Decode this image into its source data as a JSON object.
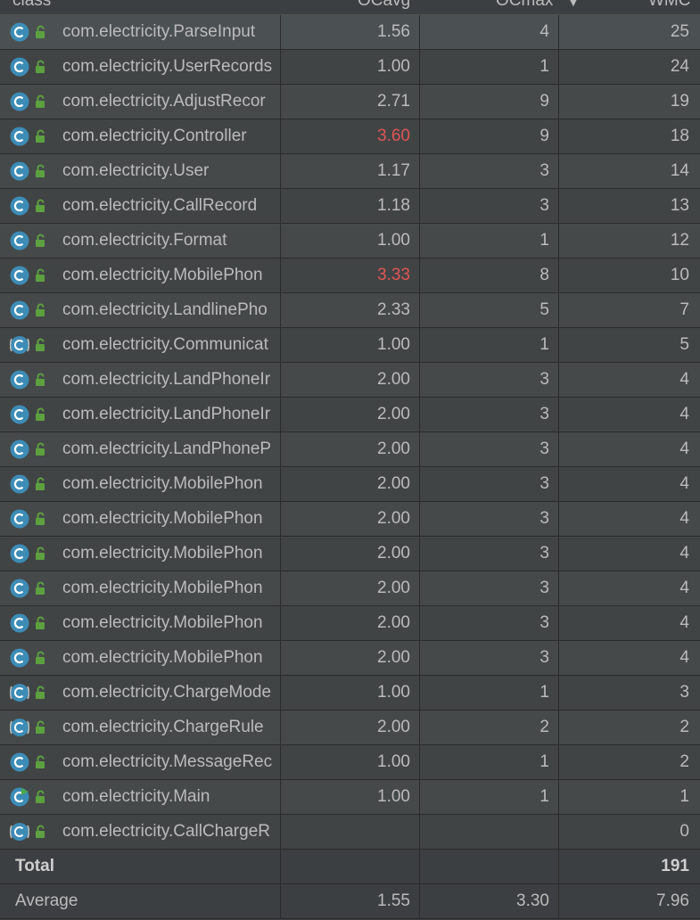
{
  "columns": [
    "class",
    "OCavg",
    "OCmax",
    "WMC"
  ],
  "sort_indicator": "▼",
  "rows": [
    {
      "name": "com.electricity.ParseInput",
      "icon": "class-icon",
      "avg": "1.56",
      "max": "4",
      "wmc": "25",
      "warn": false
    },
    {
      "name": "com.electricity.UserRecords",
      "icon": "class-icon",
      "avg": "1.00",
      "max": "1",
      "wmc": "24",
      "warn": false
    },
    {
      "name": "com.electricity.AdjustRecor",
      "icon": "class-icon",
      "avg": "2.71",
      "max": "9",
      "wmc": "19",
      "warn": false
    },
    {
      "name": "com.electricity.Controller",
      "icon": "class-icon",
      "avg": "3.60",
      "max": "9",
      "wmc": "18",
      "warn": true
    },
    {
      "name": "com.electricity.User",
      "icon": "class-icon",
      "avg": "1.17",
      "max": "3",
      "wmc": "14",
      "warn": false
    },
    {
      "name": "com.electricity.CallRecord",
      "icon": "class-icon",
      "avg": "1.18",
      "max": "3",
      "wmc": "13",
      "warn": false
    },
    {
      "name": "com.electricity.Format",
      "icon": "class-icon",
      "avg": "1.00",
      "max": "1",
      "wmc": "12",
      "warn": false
    },
    {
      "name": "com.electricity.MobilePhon",
      "icon": "class-icon",
      "avg": "3.33",
      "max": "8",
      "wmc": "10",
      "warn": true
    },
    {
      "name": "com.electricity.LandlinePho",
      "icon": "class-icon",
      "avg": "2.33",
      "max": "5",
      "wmc": "7",
      "warn": false
    },
    {
      "name": "com.electricity.Communicat",
      "icon": "abstract-class-icon",
      "avg": "1.00",
      "max": "1",
      "wmc": "5",
      "warn": false
    },
    {
      "name": "com.electricity.LandPhoneIr",
      "icon": "class-icon",
      "avg": "2.00",
      "max": "3",
      "wmc": "4",
      "warn": false
    },
    {
      "name": "com.electricity.LandPhoneIr",
      "icon": "class-icon",
      "avg": "2.00",
      "max": "3",
      "wmc": "4",
      "warn": false
    },
    {
      "name": "com.electricity.LandPhoneP",
      "icon": "class-icon",
      "avg": "2.00",
      "max": "3",
      "wmc": "4",
      "warn": false
    },
    {
      "name": "com.electricity.MobilePhon",
      "icon": "class-icon",
      "avg": "2.00",
      "max": "3",
      "wmc": "4",
      "warn": false
    },
    {
      "name": "com.electricity.MobilePhon",
      "icon": "class-icon",
      "avg": "2.00",
      "max": "3",
      "wmc": "4",
      "warn": false
    },
    {
      "name": "com.electricity.MobilePhon",
      "icon": "class-icon",
      "avg": "2.00",
      "max": "3",
      "wmc": "4",
      "warn": false
    },
    {
      "name": "com.electricity.MobilePhon",
      "icon": "class-icon",
      "avg": "2.00",
      "max": "3",
      "wmc": "4",
      "warn": false
    },
    {
      "name": "com.electricity.MobilePhon",
      "icon": "class-icon",
      "avg": "2.00",
      "max": "3",
      "wmc": "4",
      "warn": false
    },
    {
      "name": "com.electricity.MobilePhon",
      "icon": "class-icon",
      "avg": "2.00",
      "max": "3",
      "wmc": "4",
      "warn": false
    },
    {
      "name": "com.electricity.ChargeMode",
      "icon": "abstract-class-icon",
      "avg": "1.00",
      "max": "1",
      "wmc": "3",
      "warn": false
    },
    {
      "name": "com.electricity.ChargeRule",
      "icon": "abstract-class-icon",
      "avg": "2.00",
      "max": "2",
      "wmc": "2",
      "warn": false
    },
    {
      "name": "com.electricity.MessageRec",
      "icon": "class-icon",
      "avg": "1.00",
      "max": "1",
      "wmc": "2",
      "warn": false
    },
    {
      "name": "com.electricity.Main",
      "icon": "main-class-icon",
      "avg": "1.00",
      "max": "1",
      "wmc": "1",
      "warn": false
    },
    {
      "name": "com.electricity.CallChargeR",
      "icon": "abstract-class-icon",
      "avg": "",
      "max": "",
      "wmc": "0",
      "warn": false
    }
  ],
  "total": {
    "label": "Total",
    "avg": "",
    "max": "",
    "wmc": "191"
  },
  "average": {
    "label": "Average",
    "avg": "1.55",
    "max": "3.30",
    "wmc": "7.96"
  },
  "colors": {
    "warn": "#e05555",
    "class_icon": "#3d8cb6",
    "lock_icon": "#5da040",
    "main_badge": "#4ca64c"
  }
}
